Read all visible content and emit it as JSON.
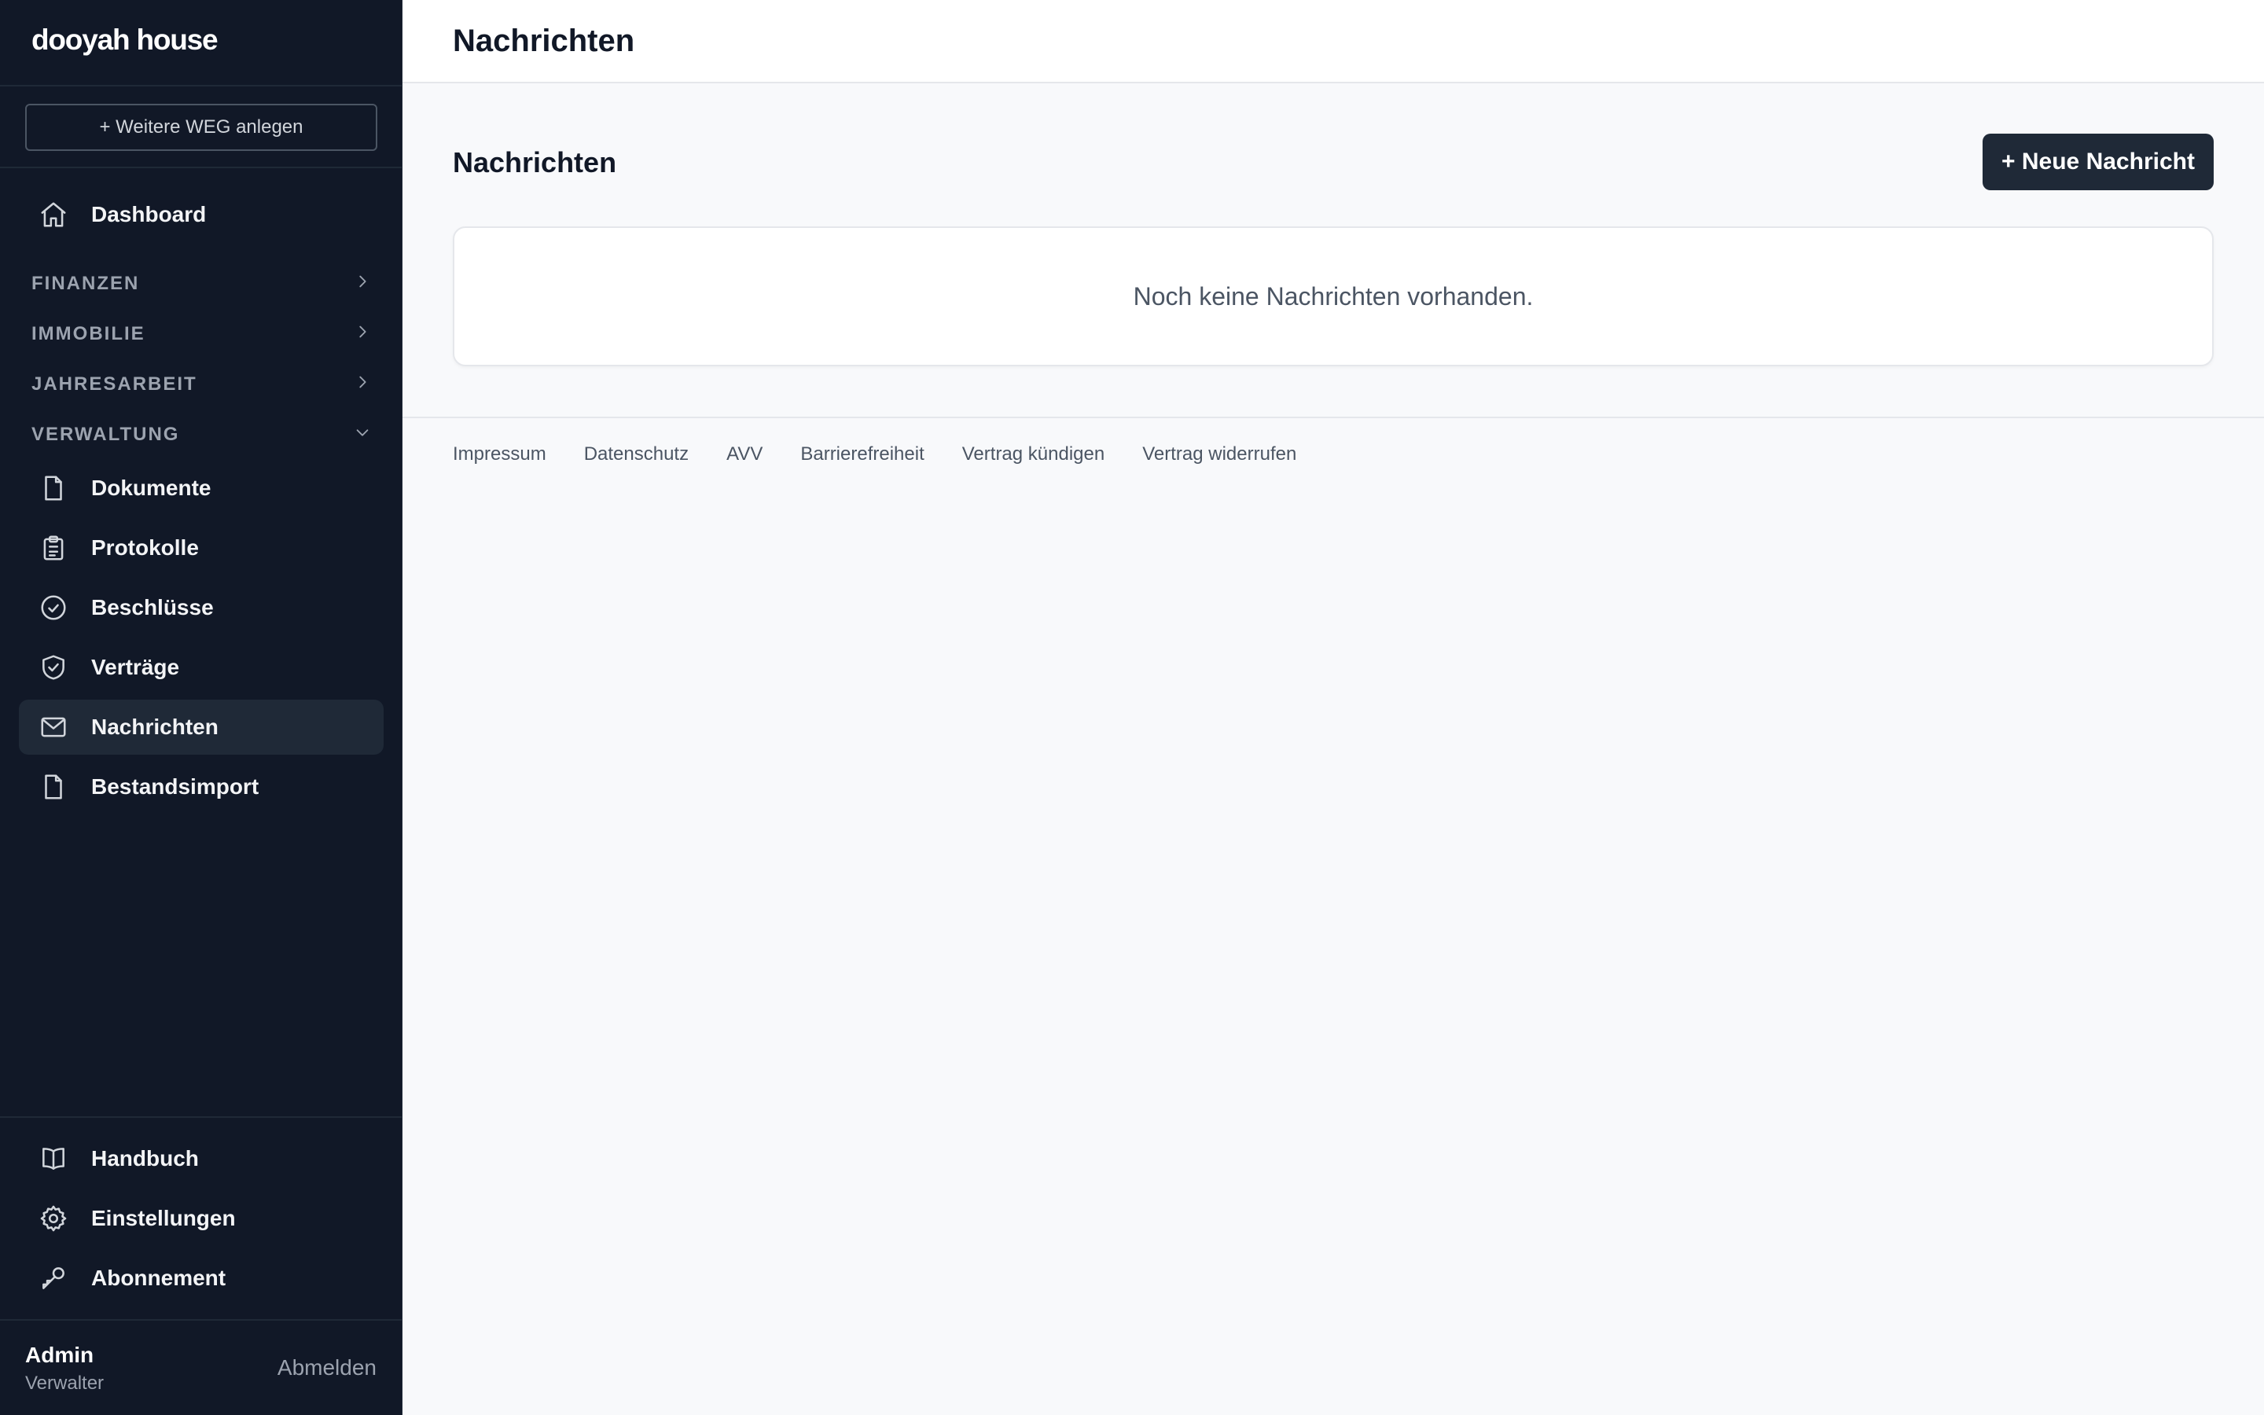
{
  "brand": "dooyah house",
  "sidebar": {
    "add_weg": "+ Weitere WEG anlegen",
    "dashboard": "Dashboard",
    "groups": [
      {
        "label": "FINANZEN",
        "expanded": false
      },
      {
        "label": "IMMOBILIE",
        "expanded": false
      },
      {
        "label": "JAHRESARBEIT",
        "expanded": false
      },
      {
        "label": "VERWALTUNG",
        "expanded": true
      }
    ],
    "verwaltung_items": [
      {
        "label": "Dokumente",
        "icon": "document-icon"
      },
      {
        "label": "Protokolle",
        "icon": "clipboard-icon"
      },
      {
        "label": "Beschlüsse",
        "icon": "check-circle-icon"
      },
      {
        "label": "Verträge",
        "icon": "shield-check-icon"
      },
      {
        "label": "Nachrichten",
        "icon": "mail-icon",
        "active": true
      },
      {
        "label": "Bestandsimport",
        "icon": "document-icon"
      }
    ],
    "bottom_items": [
      {
        "label": "Handbuch",
        "icon": "book-icon"
      },
      {
        "label": "Einstellungen",
        "icon": "gear-icon"
      },
      {
        "label": "Abonnement",
        "icon": "key-icon"
      }
    ],
    "user": {
      "name": "Admin",
      "role": "Verwalter",
      "logout": "Abmelden"
    }
  },
  "header": {
    "title": "Nachrichten"
  },
  "main": {
    "section_title": "Nachrichten",
    "new_button": "+ Neue Nachricht",
    "empty_message": "Noch keine Nachrichten vorhanden."
  },
  "footer": {
    "links": [
      "Impressum",
      "Datenschutz",
      "AVV",
      "Barrierefreiheit",
      "Vertrag kündigen",
      "Vertrag widerrufen"
    ]
  },
  "colors": {
    "sidebar_bg": "#111827",
    "active_bg": "#1f2937",
    "primary_button": "#1f2937",
    "page_bg": "#f8f9fb"
  }
}
